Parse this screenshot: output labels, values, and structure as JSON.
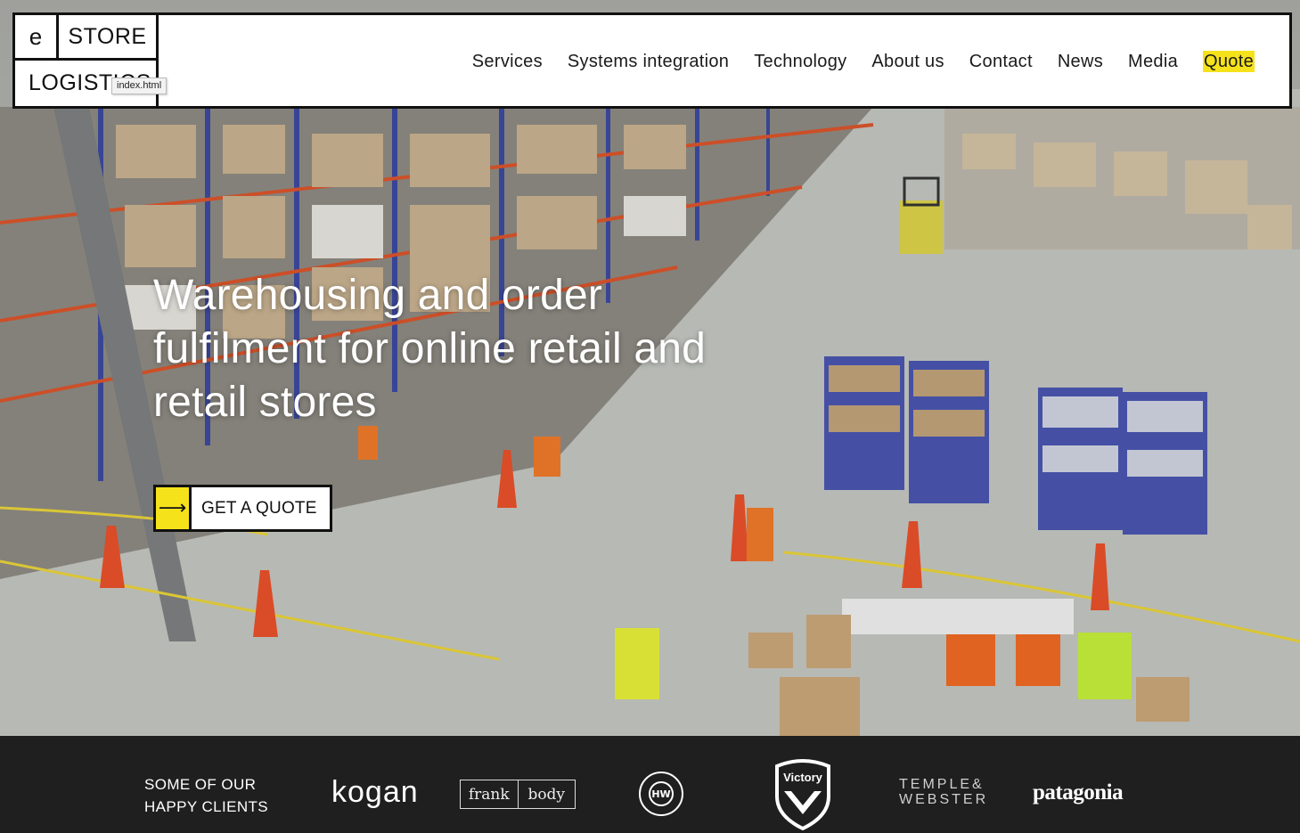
{
  "header": {
    "logo": {
      "cell_e": "e",
      "cell_store": "STORE",
      "cell_logistics": "LOGISTICS"
    },
    "tooltip": "index.html",
    "nav": [
      {
        "label": "Services"
      },
      {
        "label": "Systems integration"
      },
      {
        "label": "Technology"
      },
      {
        "label": "About us"
      },
      {
        "label": "Contact"
      },
      {
        "label": "News"
      },
      {
        "label": "Media"
      },
      {
        "label": "Quote"
      }
    ]
  },
  "hero": {
    "headline": "Warehousing and order fulfilment for online retail and retail stores",
    "cta": {
      "arrow_icon": "arrow-right-icon",
      "label": "GET A QUOTE"
    }
  },
  "clients": {
    "heading_line1": "SOME OF OUR",
    "heading_line2": "HAPPY CLIENTS",
    "logos": {
      "kogan": "kogan",
      "frank_left": "frank",
      "frank_right": "body",
      "hw": "HW",
      "victory": "Victory",
      "temple_line1": "TEMPLE&",
      "temple_line2": "WEBSTER",
      "patagonia": "patagonia"
    }
  },
  "colors": {
    "accent_yellow": "#f6e21b",
    "border": "#111111",
    "footer_bg": "#1f1f1f"
  }
}
